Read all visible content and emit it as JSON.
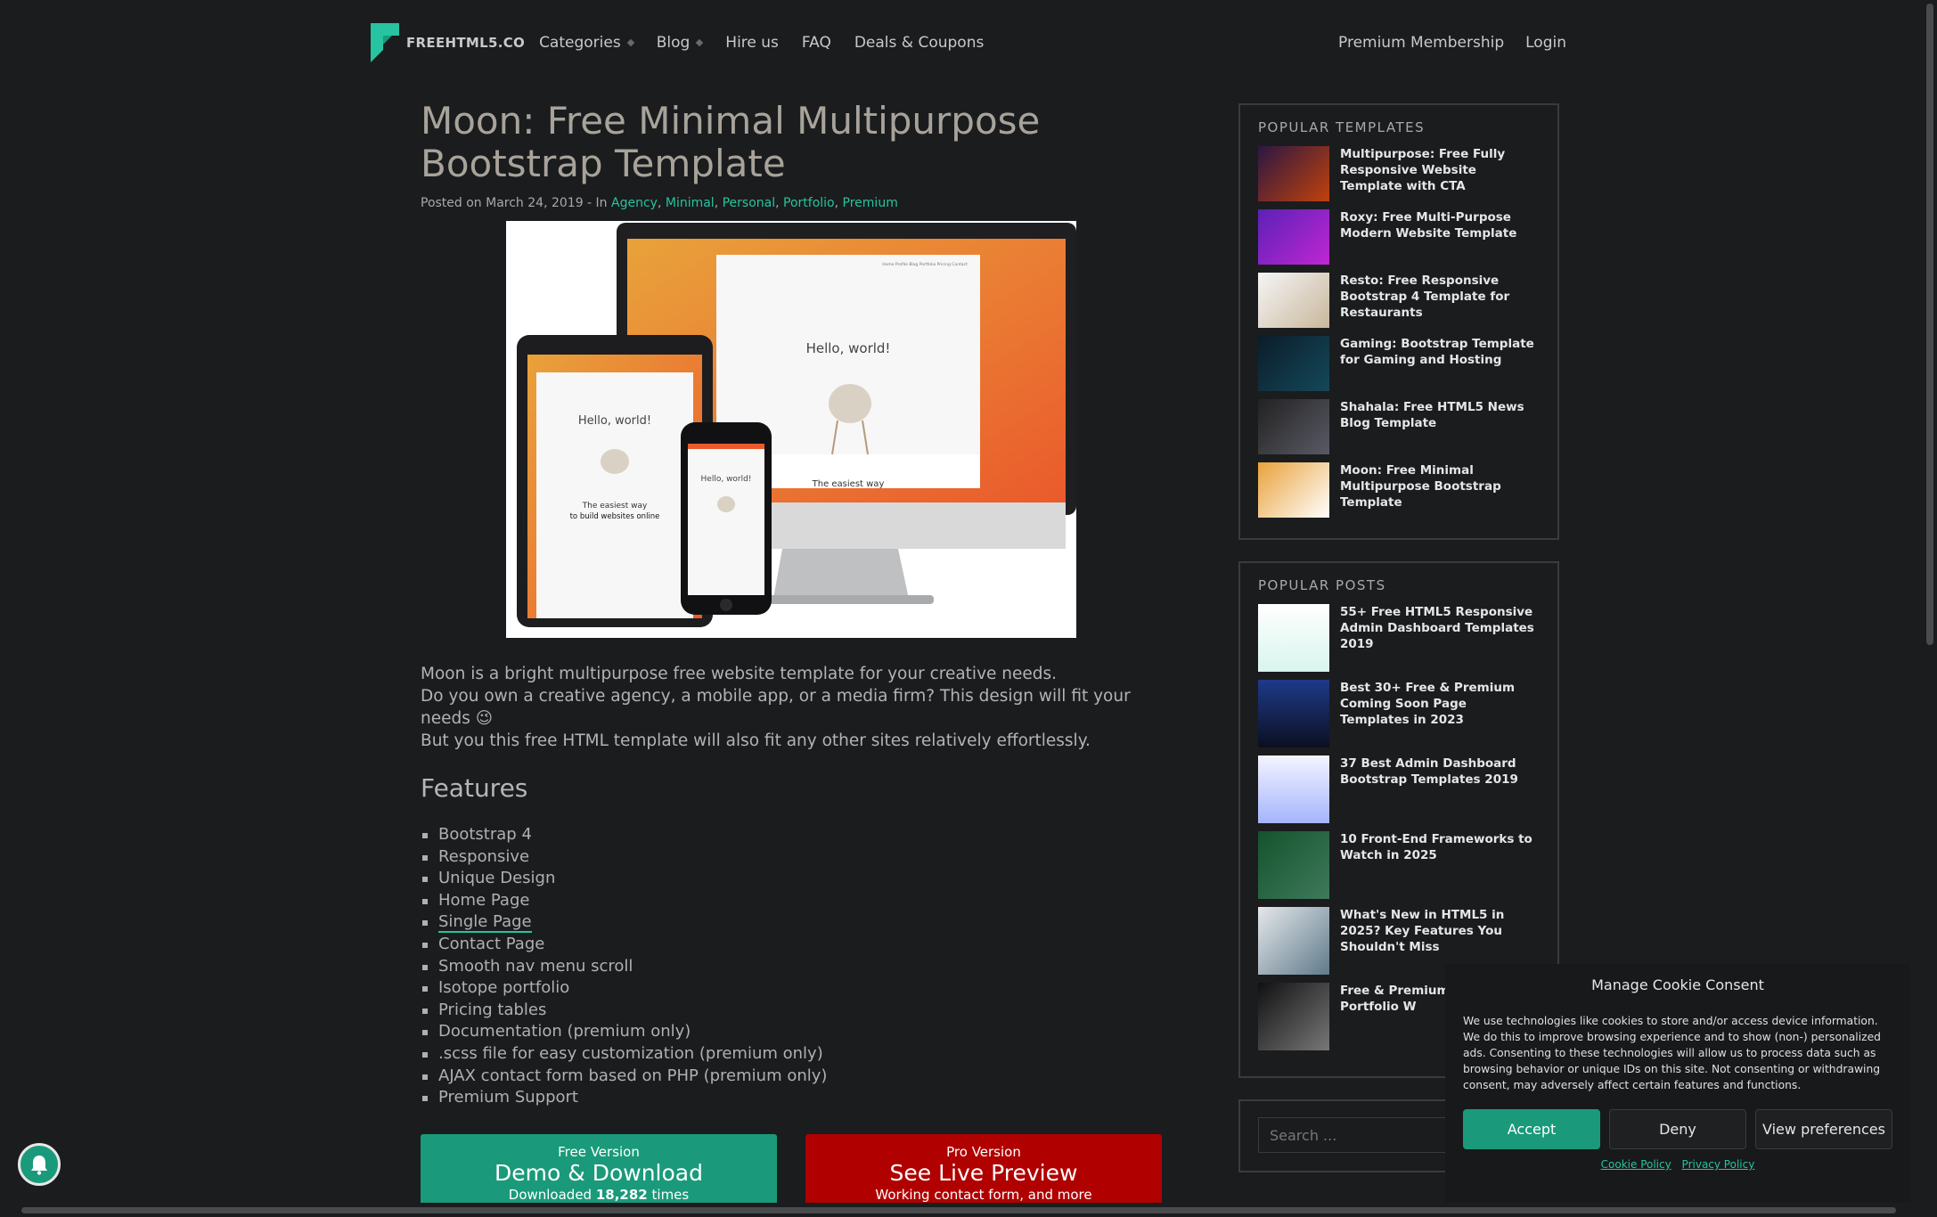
{
  "nav": {
    "logo_text": "FREEHTML5.CO",
    "left_items": [
      {
        "label": "Categories",
        "has_dropdown": true
      },
      {
        "label": "Blog",
        "has_dropdown": true
      },
      {
        "label": "Hire us",
        "has_dropdown": false
      },
      {
        "label": "FAQ",
        "has_dropdown": false
      },
      {
        "label": "Deals & Coupons",
        "has_dropdown": false
      }
    ],
    "right_items": [
      "Premium Membership",
      "Login"
    ]
  },
  "article": {
    "title": "Moon: Free Minimal Multipurpose Bootstrap Template",
    "meta_prefix": "Posted on March 24, 2019 - In",
    "tags": [
      "Agency",
      "Minimal",
      "Personal",
      "Portfolio",
      "Premium"
    ],
    "hero": {
      "hello": "Hello, world!",
      "easiest": "The easiest way",
      "to_build": "to build websites online",
      "nav_links": "Home  Profile  Blog  Portfolio  Pricing  Contact"
    },
    "intro_lines": [
      "Moon is a bright multipurpose free website template for your creative needs.",
      "Do you own a creative agency, a mobile app, or a media firm? This design will fit your needs 😉",
      "But you this free HTML template will also fit any other sites relatively effortlessly."
    ],
    "features_heading": "Features",
    "features": [
      "Bootstrap 4",
      "Responsive",
      "Unique Design",
      "Home Page",
      "Single Page",
      "Contact Page",
      "Smooth nav menu scroll",
      "Isotope portfolio",
      "Pricing tables",
      "Documentation (premium only)",
      ".scss file for easy customization (premium only)",
      "AJAX contact form based on PHP (premium only)",
      "Premium Support"
    ],
    "cta_free": {
      "top": "Free Version",
      "big": "Demo & Download",
      "sub_pre": "Downloaded ",
      "count": "18,282",
      "sub_post": " times"
    },
    "cta_pro": {
      "top": "Pro Version",
      "big": "See Live Preview",
      "sub": "Working contact form, and more"
    }
  },
  "sidebar": {
    "popular_templates": {
      "heading": "POPULAR TEMPLATES",
      "items": [
        "Multipurpose: Free Fully Responsive Website Template with CTA",
        "Roxy: Free Multi-Purpose Modern Website Template",
        "Resto: Free Responsive Bootstrap 4 Template for Restaurants",
        "Gaming: Bootstrap Template for Gaming and Hosting",
        "Shahala: Free HTML5 News Blog Template",
        "Moon: Free Minimal Multipurpose Bootstrap Template"
      ]
    },
    "popular_posts": {
      "heading": "POPULAR POSTS",
      "items": [
        "55+ Free HTML5 Responsive Admin Dashboard Templates 2019",
        "Best 30+ Free & Premium Coming Soon Page Templates in 2023",
        "37 Best Admin Dashboard Bootstrap Templates 2019",
        "10 Front-End Frameworks to Watch in 2025",
        "What's New in HTML5 in 2025? Key Features You Shouldn't Miss",
        "Free & Premium Ph Creative Portfolio W"
      ]
    },
    "search_placeholder": "Search ..."
  },
  "cookie": {
    "title": "Manage Cookie Consent",
    "text": "We use technologies like cookies to store and/or access device information. We do this to improve browsing experience and to show (non-) personalized ads. Consenting to these technologies will allow us to process data such as browsing behavior or unique IDs on this site. Not consenting or withdrawing consent, may adversely affect certain features and functions.",
    "accept": "Accept",
    "deny": "Deny",
    "prefs": "View preferences",
    "link_cookie": "Cookie Policy",
    "link_privacy": "Privacy Policy"
  },
  "colors": {
    "accent": "#26c4a0",
    "free_btn": "#1a9a7a",
    "pro_btn": "#b00000",
    "bg": "#1b1c1e"
  }
}
